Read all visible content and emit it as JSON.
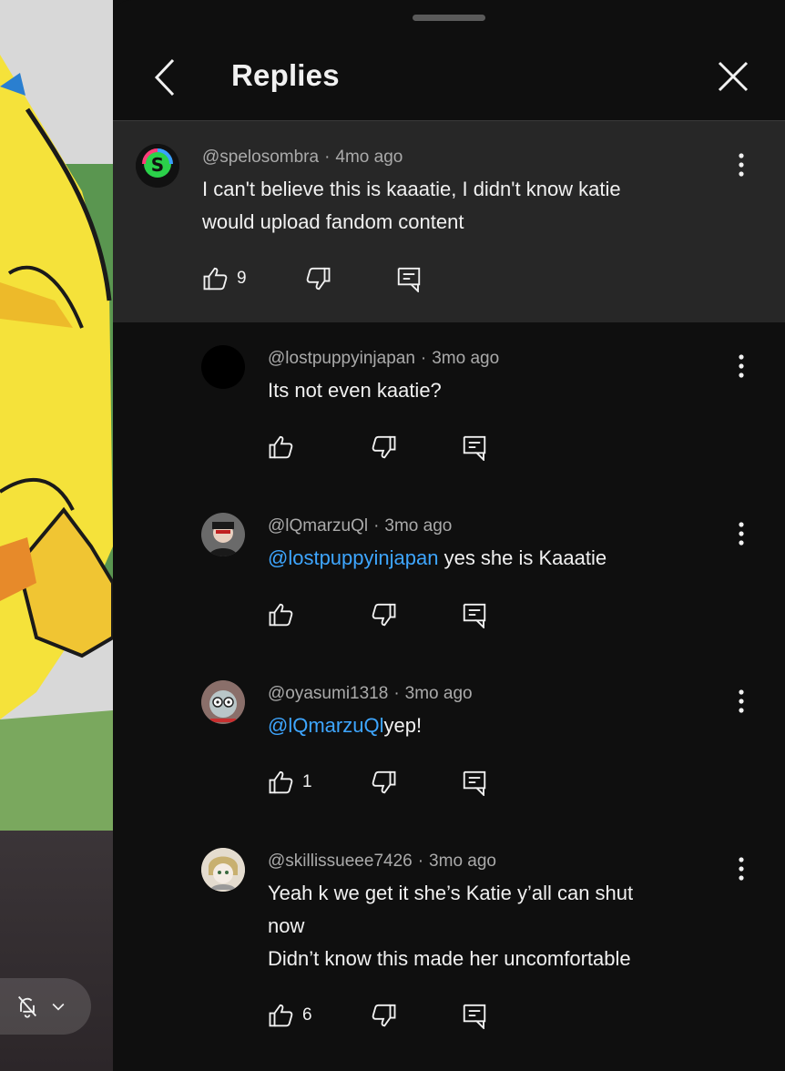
{
  "header": {
    "title": "Replies"
  },
  "comments": [
    {
      "author": "@spelosombra",
      "time": "4mo ago",
      "text_lines": [
        "I can't believe this is kaaatie, I didn't know katie",
        "would upload fandom content"
      ],
      "likes": "9",
      "avatar_color": "#1a1a1a"
    },
    {
      "author": "@lostpuppyinjapan",
      "time": "3mo ago",
      "text_lines": [
        "Its not even kaatie?"
      ],
      "likes": "",
      "avatar_color": "#000000"
    },
    {
      "author": "@lQmarzuQl",
      "time": "3mo ago",
      "mention": "@lostpuppyinjapan",
      "text": " yes she is Kaaatie",
      "likes": "",
      "avatar_color": "#3a3a3a"
    },
    {
      "author": "@oyasumi1318",
      "time": "3mo ago",
      "mention": "@lQmarzuQl",
      "text": "yep!",
      "likes": "1",
      "avatar_color": "#6b5a58"
    },
    {
      "author": "@skillissueee7426",
      "time": "3mo ago",
      "text_lines": [
        "Yeah k we get it she’s Katie y’all can shut",
        "now",
        "Didn’t know this made her uncomfortable"
      ],
      "likes": "6",
      "avatar_color": "#d8d0c4"
    }
  ],
  "colors": {
    "mention": "#3ea6ff",
    "panel_bg": "#0f0f0f",
    "highlight_bg": "#272727"
  },
  "icons": [
    "chevron-left-icon",
    "close-icon",
    "like-icon",
    "dislike-icon",
    "reply-icon",
    "more-vert-icon",
    "bell-off-icon",
    "chevron-down-icon"
  ]
}
